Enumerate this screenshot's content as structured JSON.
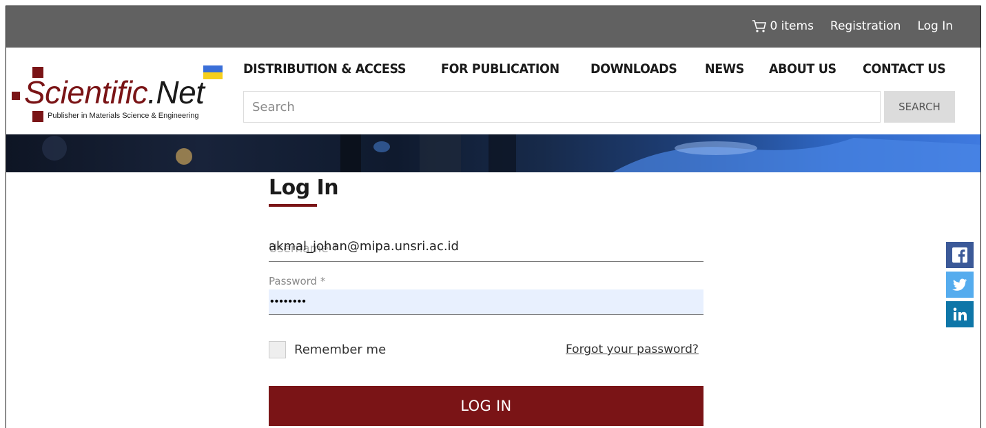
{
  "topbar": {
    "cart_label": "0 items",
    "registration": "Registration",
    "login": "Log In"
  },
  "logo": {
    "name_a": "Scientific",
    "name_b": ".Net",
    "tagline": "Publisher in Materials Science & Engineering"
  },
  "nav": {
    "items": [
      "DISTRIBUTION & ACCESS",
      "FOR PUBLICATION",
      "DOWNLOADS",
      "NEWS",
      "ABOUT US",
      "CONTACT US"
    ]
  },
  "search": {
    "placeholder": "Search",
    "button": "SEARCH"
  },
  "login": {
    "title": "Log In",
    "email_label": "Username *",
    "email_value": "akmal_johan@mipa.unsri.ac.id",
    "password_label": "Password *",
    "password_value": "••••••••",
    "remember": "Remember me",
    "forgot": "Forgot your password?",
    "submit": "LOG IN"
  },
  "colors": {
    "brand": "#7a1416",
    "topbar": "#616161",
    "facebook": "#3b5998",
    "twitter": "#55acee",
    "linkedin": "#0e76a8"
  }
}
